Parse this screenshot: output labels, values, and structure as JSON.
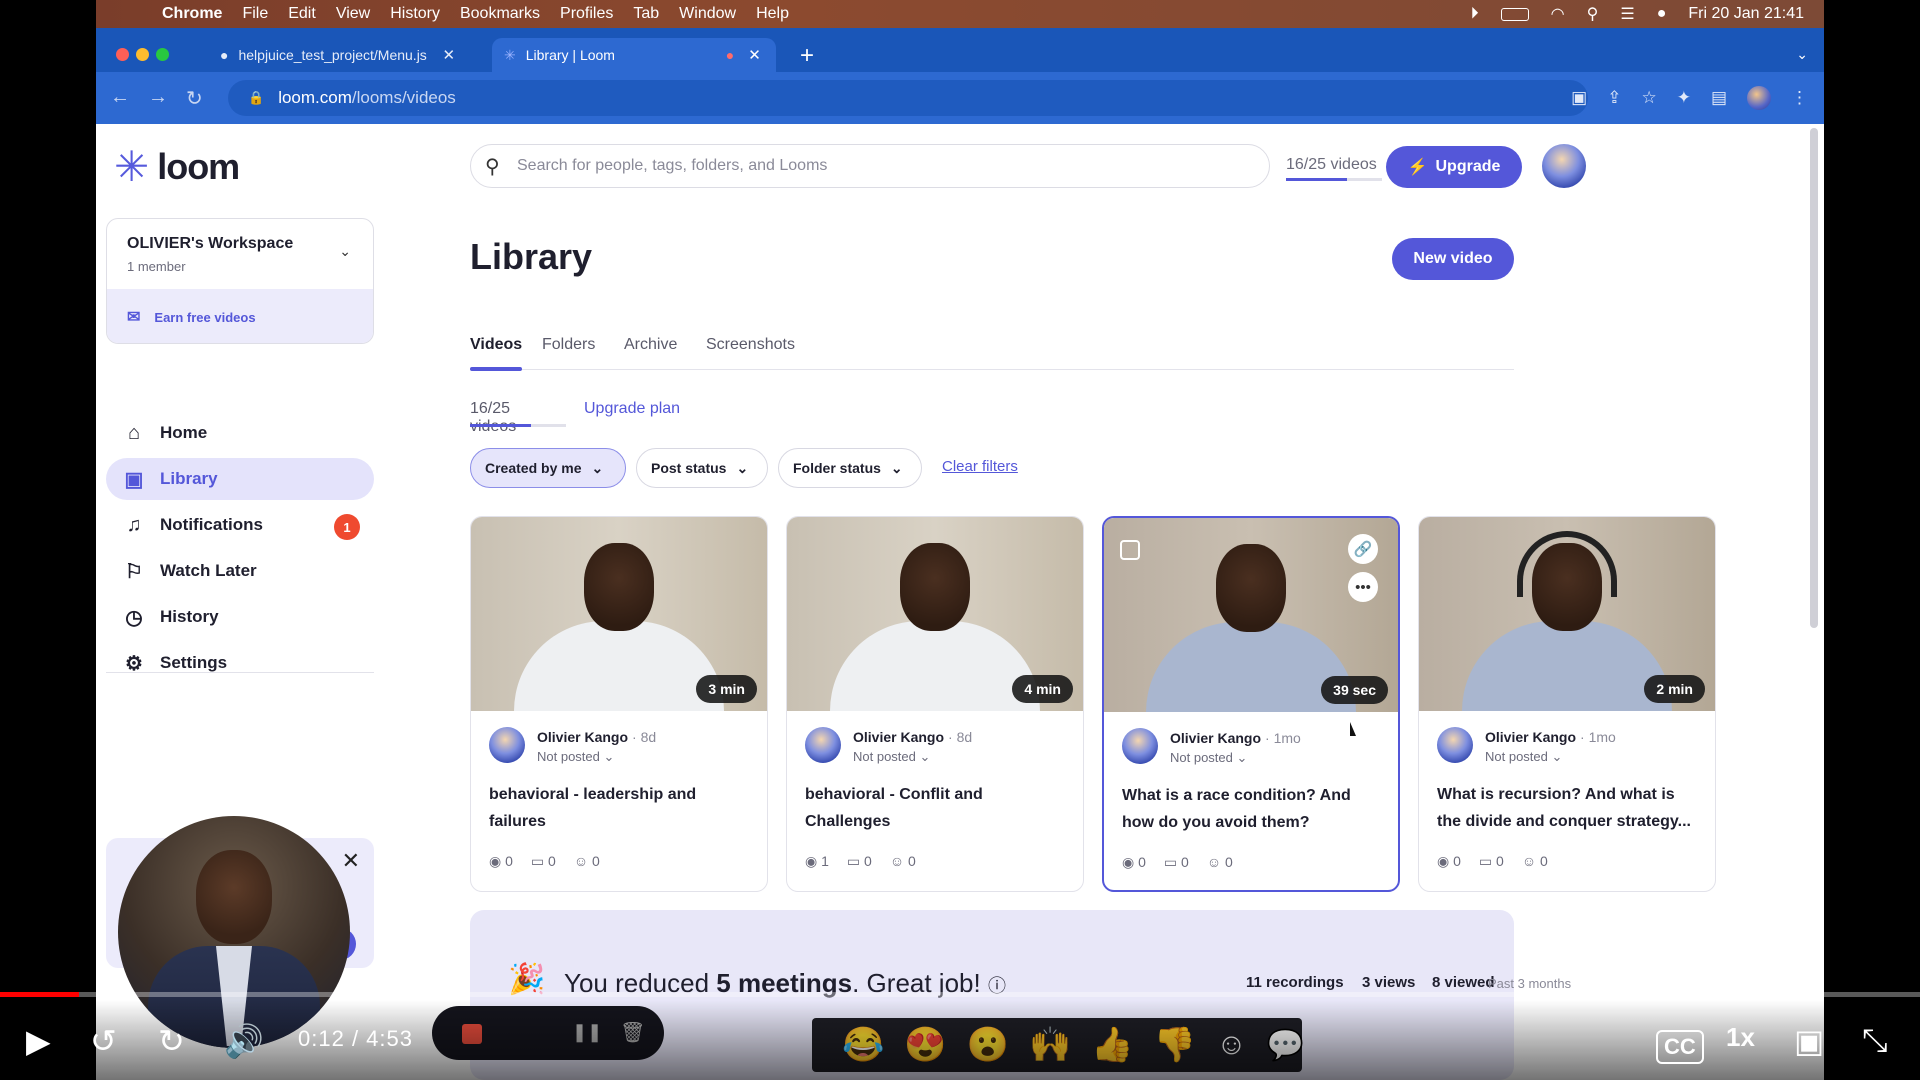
{
  "menubar": {
    "app": "Chrome",
    "items": [
      "File",
      "Edit",
      "View",
      "History",
      "Bookmarks",
      "Profiles",
      "Tab",
      "Window",
      "Help"
    ],
    "datetime": "Fri 20 Jan  21:41"
  },
  "browser": {
    "tabs": [
      {
        "title": "helpjuice_test_project/Menu.js",
        "icon": "github-icon"
      },
      {
        "title": "Library | Loom",
        "icon": "loom-icon"
      }
    ],
    "url_host": "loom.com",
    "url_path": "/looms/videos"
  },
  "sidebar": {
    "logo": "loom",
    "workspace_name": "OLIVIER's Workspace",
    "workspace_members": "1 member",
    "earn_free": "Earn free videos",
    "nav": [
      {
        "label": "Home",
        "icon": "home-icon"
      },
      {
        "label": "Library",
        "icon": "library-icon",
        "active": true
      },
      {
        "label": "Notifications",
        "icon": "bell-icon",
        "badge": "1"
      },
      {
        "label": "Watch Later",
        "icon": "bookmark-icon"
      },
      {
        "label": "History",
        "icon": "clock-icon"
      },
      {
        "label": "Settings",
        "icon": "gear-icon"
      }
    ]
  },
  "header": {
    "search_placeholder": "Search for people, tags, folders, and Looms",
    "quota": "16/25 videos",
    "quota_fraction": 0.64,
    "upgrade": "Upgrade"
  },
  "library": {
    "title": "Library",
    "new_video": "New video",
    "tabs": [
      "Videos",
      "Folders",
      "Archive",
      "Screenshots"
    ],
    "count": "16/25 videos",
    "upgrade_plan": "Upgrade plan",
    "filters": [
      "Created by me",
      "Post status",
      "Folder status"
    ],
    "clear_filters": "Clear filters"
  },
  "videos": [
    {
      "duration": "3 min",
      "author": "Olivier Kango",
      "age": "· 8d",
      "status": "Not posted",
      "title": "behavioral - leadership and failures",
      "views": "0",
      "comments": "0",
      "reactions": "0"
    },
    {
      "duration": "4 min",
      "author": "Olivier Kango",
      "age": "· 8d",
      "status": "Not posted",
      "title": "behavioral - Conflit and Challenges",
      "views": "1",
      "comments": "0",
      "reactions": "0"
    },
    {
      "duration": "39 sec",
      "author": "Olivier Kango",
      "age": "· 1mo",
      "status": "Not posted",
      "title": "What is a race condition? And how do you avoid them?",
      "views": "0",
      "comments": "0",
      "reactions": "0"
    },
    {
      "duration": "2 min",
      "author": "Olivier Kango",
      "age": "· 1mo",
      "status": "Not posted",
      "title": "What is recursion? And what is the divide and conquer strategy...",
      "views": "0",
      "comments": "0",
      "reactions": "0"
    }
  ],
  "banner": {
    "prefix": "You reduced ",
    "highlight": "5 meetings",
    "suffix": ". Great job!",
    "recordings": "11 recordings",
    "views": "3 views",
    "viewed": "8 viewed",
    "period": "Past 3 months"
  },
  "player": {
    "current": "0:12",
    "total": "4:53",
    "rate": "1x",
    "progress": 0.041,
    "emojis": [
      "😂",
      "😍",
      "😮",
      "🙌",
      "👍",
      "👎"
    ]
  }
}
